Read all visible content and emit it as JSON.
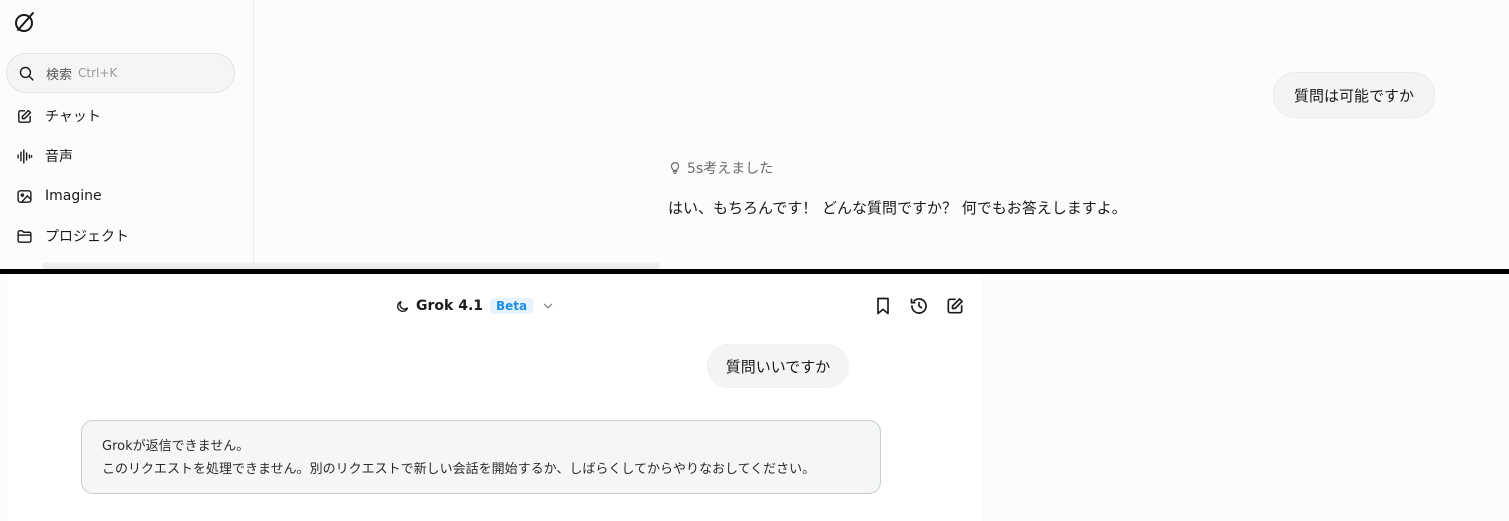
{
  "sidebar": {
    "search": {
      "placeholder": "検索",
      "shortcut": "Ctrl+K"
    },
    "items": [
      {
        "label": "チャット",
        "icon": "pencil-square-icon"
      },
      {
        "label": "音声",
        "icon": "waveform-icon"
      },
      {
        "label": "Imagine",
        "icon": "image-icon"
      },
      {
        "label": "プロジェクト",
        "icon": "folder-icon"
      }
    ]
  },
  "top_chat": {
    "user_message": "質問は可能ですか",
    "thinking": "5s考えました",
    "assistant_message": "はい、もちろんです！ どんな質問ですか？ 何でもお答えしますよ。"
  },
  "bottom_chat": {
    "header": {
      "model_name": "Grok 4.1",
      "badge": "Beta"
    },
    "toolbar": {
      "icons": [
        "bookmark-icon",
        "history-icon",
        "new-chat-icon"
      ]
    },
    "user_message": "質問いいですか",
    "error": {
      "title": "Grokが返信できません。",
      "body": "このリクエストを処理できません。別のリクエストで新しい会話を開始するか、しばらくしてからやりなおしてください。"
    }
  },
  "colors": {
    "accent": "#1d8fe6",
    "badge_bg": "#e6f3fd",
    "bubble_bg": "#f3f4f4",
    "error_border": "#c9cdcf"
  }
}
